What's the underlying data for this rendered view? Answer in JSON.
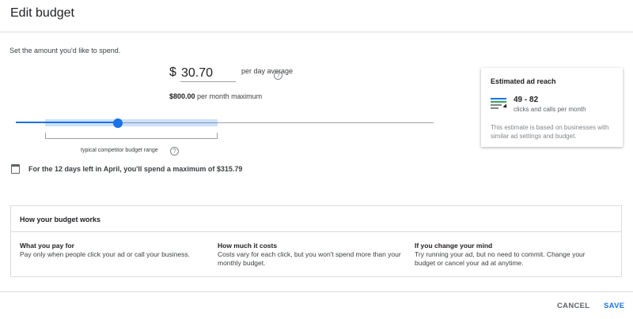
{
  "dialog": {
    "title": "Edit budget",
    "subtitle": "Set the amount you'd like to spend."
  },
  "budget": {
    "currency_symbol": "$",
    "amount": "30.70",
    "per_day_label": "per day average",
    "month_max_bold": "$800.00",
    "month_max_rest": " per month maximum",
    "slider_level_fraction": 0.245,
    "range_label": "typical competitor budget range",
    "april_note": "For the 12 days left in April, you'll spend a maximum of $315.79"
  },
  "reach_card": {
    "title": "Estimated ad reach",
    "value": "49 - 82",
    "unit": "clicks and calls per month",
    "note": "This estimate is based on businesses with similar ad settings and budget."
  },
  "how_it_works": {
    "title": "How your budget works",
    "columns": [
      {
        "heading": "What you pay for",
        "body": "Pay only when people click your ad or call your business."
      },
      {
        "heading": "How much it costs",
        "body": "Costs vary for each click, but you won't spend more than your monthly budget."
      },
      {
        "heading": "If you change your mind",
        "body": "Try running your ad, but no need to commit. Change your budget or cancel your ad at anytime."
      }
    ]
  },
  "actions": {
    "cancel_label": "CANCEL",
    "save_label": "SAVE"
  },
  "icons": {
    "help": "help-circle-icon",
    "calendar": "calendar-icon",
    "reach": "ad-reach-icon"
  },
  "colors": {
    "accent": "#1a73e8",
    "divider": "#dadce0"
  }
}
